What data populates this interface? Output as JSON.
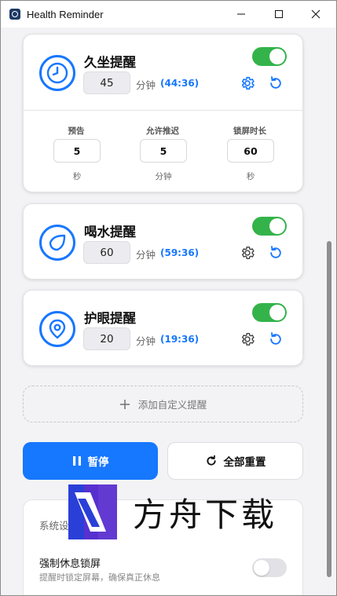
{
  "window": {
    "title": "Health Reminder"
  },
  "reminders": [
    {
      "title": "久坐提醒",
      "interval": "45",
      "unit": "分钟",
      "remaining": "(44:36)",
      "enabled": true,
      "icon": "clock-icon",
      "expanded": true,
      "options": [
        {
          "label": "预告",
          "value": "5",
          "unit": "秒"
        },
        {
          "label": "允许推迟",
          "value": "5",
          "unit": "分钟"
        },
        {
          "label": "锁屏时长",
          "value": "60",
          "unit": "秒"
        }
      ]
    },
    {
      "title": "喝水提醒",
      "interval": "60",
      "unit": "分钟",
      "remaining": "(59:36)",
      "enabled": true,
      "icon": "water-drop-icon",
      "expanded": false
    },
    {
      "title": "护眼提醒",
      "interval": "20",
      "unit": "分钟",
      "remaining": "(19:36)",
      "enabled": true,
      "icon": "eye-icon",
      "expanded": false
    }
  ],
  "add_custom": {
    "label": "添加自定义提醒"
  },
  "actions": {
    "pause_label": "暂停",
    "reset_label": "全部重置"
  },
  "system_settings": {
    "title": "系统设置",
    "items": [
      {
        "name": "强制休息锁屏",
        "description": "提醒时锁定屏幕，确保真正休息",
        "enabled": false
      }
    ]
  },
  "watermark": {
    "text": "方舟下载"
  },
  "colors": {
    "accent": "#1677ff",
    "toggle_on": "#34b34a",
    "toggle_off": "#e2e2e6"
  }
}
